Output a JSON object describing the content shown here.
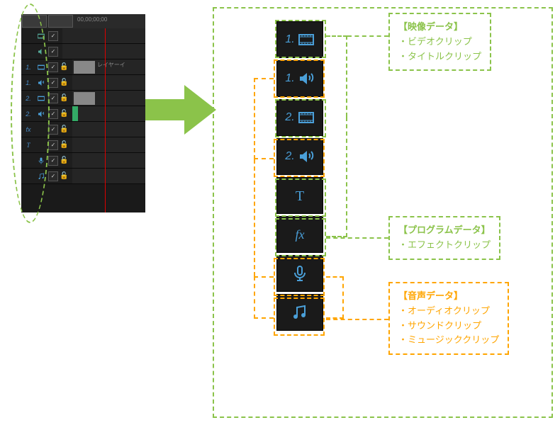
{
  "timecode": "00,00;00;00",
  "clip_label": "レイヤーイ",
  "tracks": {
    "v1": "1.",
    "a1": "1.",
    "v2": "2.",
    "a2": "2.",
    "fx": "fx",
    "t": "T"
  },
  "icons": {
    "v1_num": "1.",
    "a1_num": "1.",
    "v2_num": "2.",
    "a2_num": "2."
  },
  "labels": {
    "video": {
      "title": "【映像データ】",
      "line1": "・ビデオクリップ",
      "line2": "・タイトルクリップ"
    },
    "program": {
      "title": "【プログラムデータ】",
      "line1": "・エフェクトクリップ"
    },
    "audio": {
      "title": "【音声データ】",
      "line1": "・オーディオクリップ",
      "line2": "・サウンドクリップ",
      "line3": "・ミュージッククリップ"
    }
  }
}
